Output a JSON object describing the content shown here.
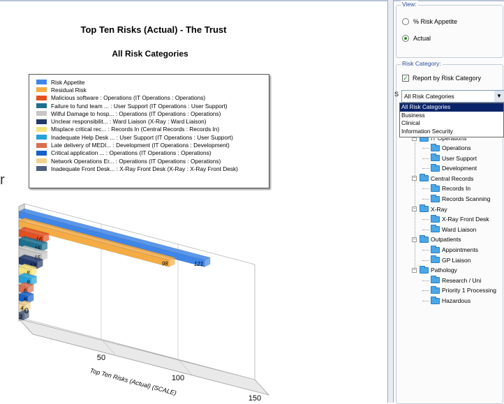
{
  "chart": {
    "title": "Top Ten Risks  (Actual) - The Trust",
    "subtitle": "All Risk Categories",
    "side_fragment": "r"
  },
  "chart_data": {
    "type": "bar",
    "orientation": "horizontal",
    "title": "Top Ten Risks  (Actual) - The Trust",
    "subtitle": "All Risk Categories",
    "xlabel": "Top Ten Risks (Actual) (SCALE)",
    "xlim": [
      0,
      150
    ],
    "x_ticks": [
      "0",
      "50",
      "100",
      "150"
    ],
    "grid": true,
    "legend_placement": "top-left",
    "categories": [
      "Risk Appetite",
      "Residual Risk",
      "Malicious software : Operations (IT Operations : Operations)",
      "Failure to fund team ... : User Support (IT Operations : User Support)",
      "Wilful Damage to hosp... : Operations (IT Operations : Operations)",
      "Unclear responsibilit... : Ward Liaison (X-Ray : Ward Liaison)",
      "Misplace critical rec... : Records In (Central Records : Records In)",
      "Inadequate Help Desk ... : User Support (IT Operations : User Support)",
      "Late delivery of MEDI... : Development (IT Operations : Development)",
      "Critical application ... : Operations (IT Operations : Operations)",
      "Network Operations Er... : Operations (IT Operations : Operations)",
      "Inadequate Front Desk... : X-Ray Front Desk (X-Ray : X-Ray Front Desk)"
    ],
    "values": [
      121,
      98,
      16,
      15,
      15,
      12,
      8,
      8,
      6,
      6,
      4,
      3
    ],
    "value_labels": [
      "121",
      "98",
      "16",
      "15",
      "15",
      "12",
      "8",
      "8",
      "6",
      "6",
      "4",
      "3"
    ],
    "colors": [
      "#3f86e8",
      "#f5ac45",
      "#e4501f",
      "#1d6f8f",
      "#c6c6c6",
      "#233a6a",
      "#f5e27b",
      "#25a2d8",
      "#d76f4e",
      "#1660c7",
      "#f3d28e",
      "#4e5e7c"
    ]
  },
  "panel": {
    "view_title": "View:",
    "view_options": [
      "% Risk Appetite",
      "Actual"
    ],
    "view_selected": 1,
    "category_title": "Risk Category:",
    "report_by_category_label": "Report by Risk Category",
    "report_by_category_checked": true,
    "category_select_value": "All Risk Categories",
    "category_options": [
      "All Risk Categories",
      "Business",
      "Clinical",
      "Information Security"
    ],
    "hidden_fragment_s": "S",
    "hidden_fragment_ops": "IT Operations"
  },
  "tree": {
    "nodes": [
      {
        "label": "Operations",
        "level": 2
      },
      {
        "label": "User Support",
        "level": 2
      },
      {
        "label": "Development",
        "level": 2
      },
      {
        "label": "Central Records",
        "level": 1
      },
      {
        "label": "Records In",
        "level": 2
      },
      {
        "label": "Records Scanning",
        "level": 2
      },
      {
        "label": "X-Ray",
        "level": 1
      },
      {
        "label": "X-Ray Front Desk",
        "level": 2
      },
      {
        "label": "Ward Liaison",
        "level": 2
      },
      {
        "label": "Outpatients",
        "level": 1
      },
      {
        "label": "Appointments",
        "level": 2
      },
      {
        "label": "GP Liaison",
        "level": 2
      },
      {
        "label": "Pathology",
        "level": 1
      },
      {
        "label": "Research / Uni",
        "level": 2
      },
      {
        "label": "Priority 1 Processing",
        "level": 2
      },
      {
        "label": "Hazardous",
        "level": 2
      }
    ]
  }
}
